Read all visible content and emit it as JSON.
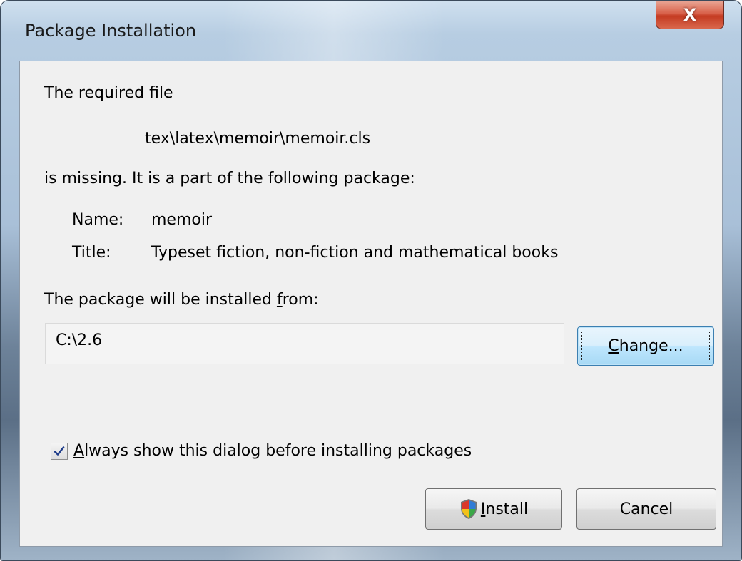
{
  "window": {
    "title": "Package Installation",
    "close_glyph": "X"
  },
  "message": {
    "line1": "The required file",
    "file_path": "tex\\latex\\memoir\\memoir.cls",
    "line2": "is missing. It is a part of the following package:"
  },
  "package": {
    "name_label": "Name:",
    "name_value": "memoir",
    "title_label": "Title:",
    "title_value": "Typeset fiction, non-fiction and mathematical books"
  },
  "source": {
    "label_pre": "The package will be installed ",
    "label_accel": "f",
    "label_post": "rom:",
    "path_value": "C:\\2.6",
    "change_accel": "C",
    "change_rest": "hange..."
  },
  "option": {
    "checked": true,
    "accel": "A",
    "rest": "lways show this dialog before installing packages"
  },
  "buttons": {
    "install_accel": "I",
    "install_rest": "nstall",
    "install_icon": "uac-shield-icon",
    "cancel_label": "Cancel"
  }
}
